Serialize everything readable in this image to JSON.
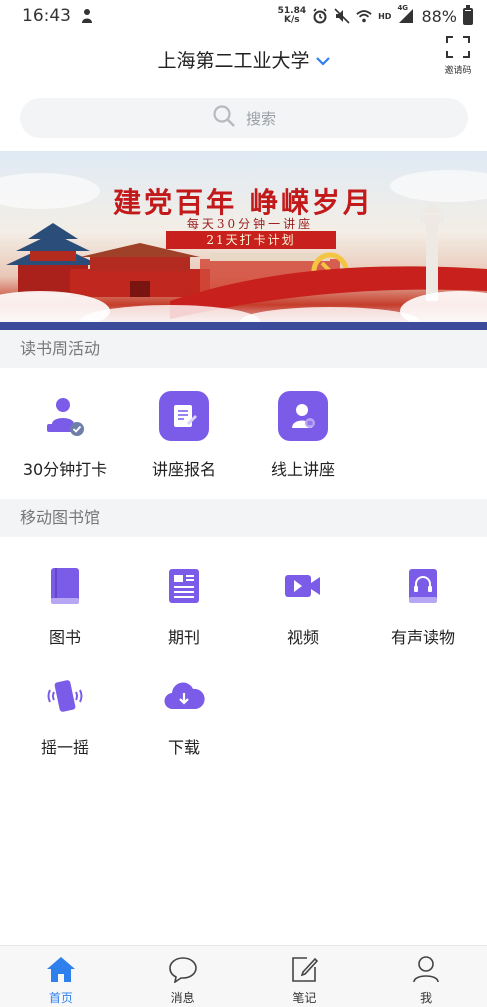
{
  "status_bar": {
    "time": "16:43",
    "net_speed_value": "51.84",
    "net_speed_unit": "K/s",
    "network_label": "HD",
    "network_gen": "4G",
    "battery_percent": "88%",
    "battery_level": 0.88
  },
  "header": {
    "title": "上海第二工业大学",
    "scan_label": "邀请码"
  },
  "search": {
    "placeholder": "搜索"
  },
  "banner": {
    "title": "建党百年 峥嵘岁月",
    "subtitle": "每天30分钟一讲座",
    "plan": "21天打卡计划"
  },
  "reading_week": {
    "title": "读书周活动",
    "items": [
      {
        "label": "30分钟打卡",
        "icon": "reader-check-icon"
      },
      {
        "label": "讲座报名",
        "icon": "form-edit-icon"
      },
      {
        "label": "线上讲座",
        "icon": "speaker-icon"
      }
    ]
  },
  "mobile_library": {
    "title": "移动图书馆",
    "items": [
      {
        "label": "图书",
        "icon": "book-icon"
      },
      {
        "label": "期刊",
        "icon": "journal-icon"
      },
      {
        "label": "视频",
        "icon": "video-icon"
      },
      {
        "label": "有声读物",
        "icon": "audiobook-icon"
      },
      {
        "label": "摇一摇",
        "icon": "shake-phone-icon"
      },
      {
        "label": "下载",
        "icon": "cloud-download-icon"
      }
    ]
  },
  "tabs": [
    {
      "label": "首页",
      "icon": "home-icon",
      "active": true
    },
    {
      "label": "消息",
      "icon": "message-icon",
      "active": false
    },
    {
      "label": "笔记",
      "icon": "note-icon",
      "active": false
    },
    {
      "label": "我",
      "icon": "user-icon",
      "active": false
    }
  ],
  "colors": {
    "accent": "#7b5ce8",
    "active_tab": "#2f80ed",
    "banner_red": "#c21a1a"
  }
}
